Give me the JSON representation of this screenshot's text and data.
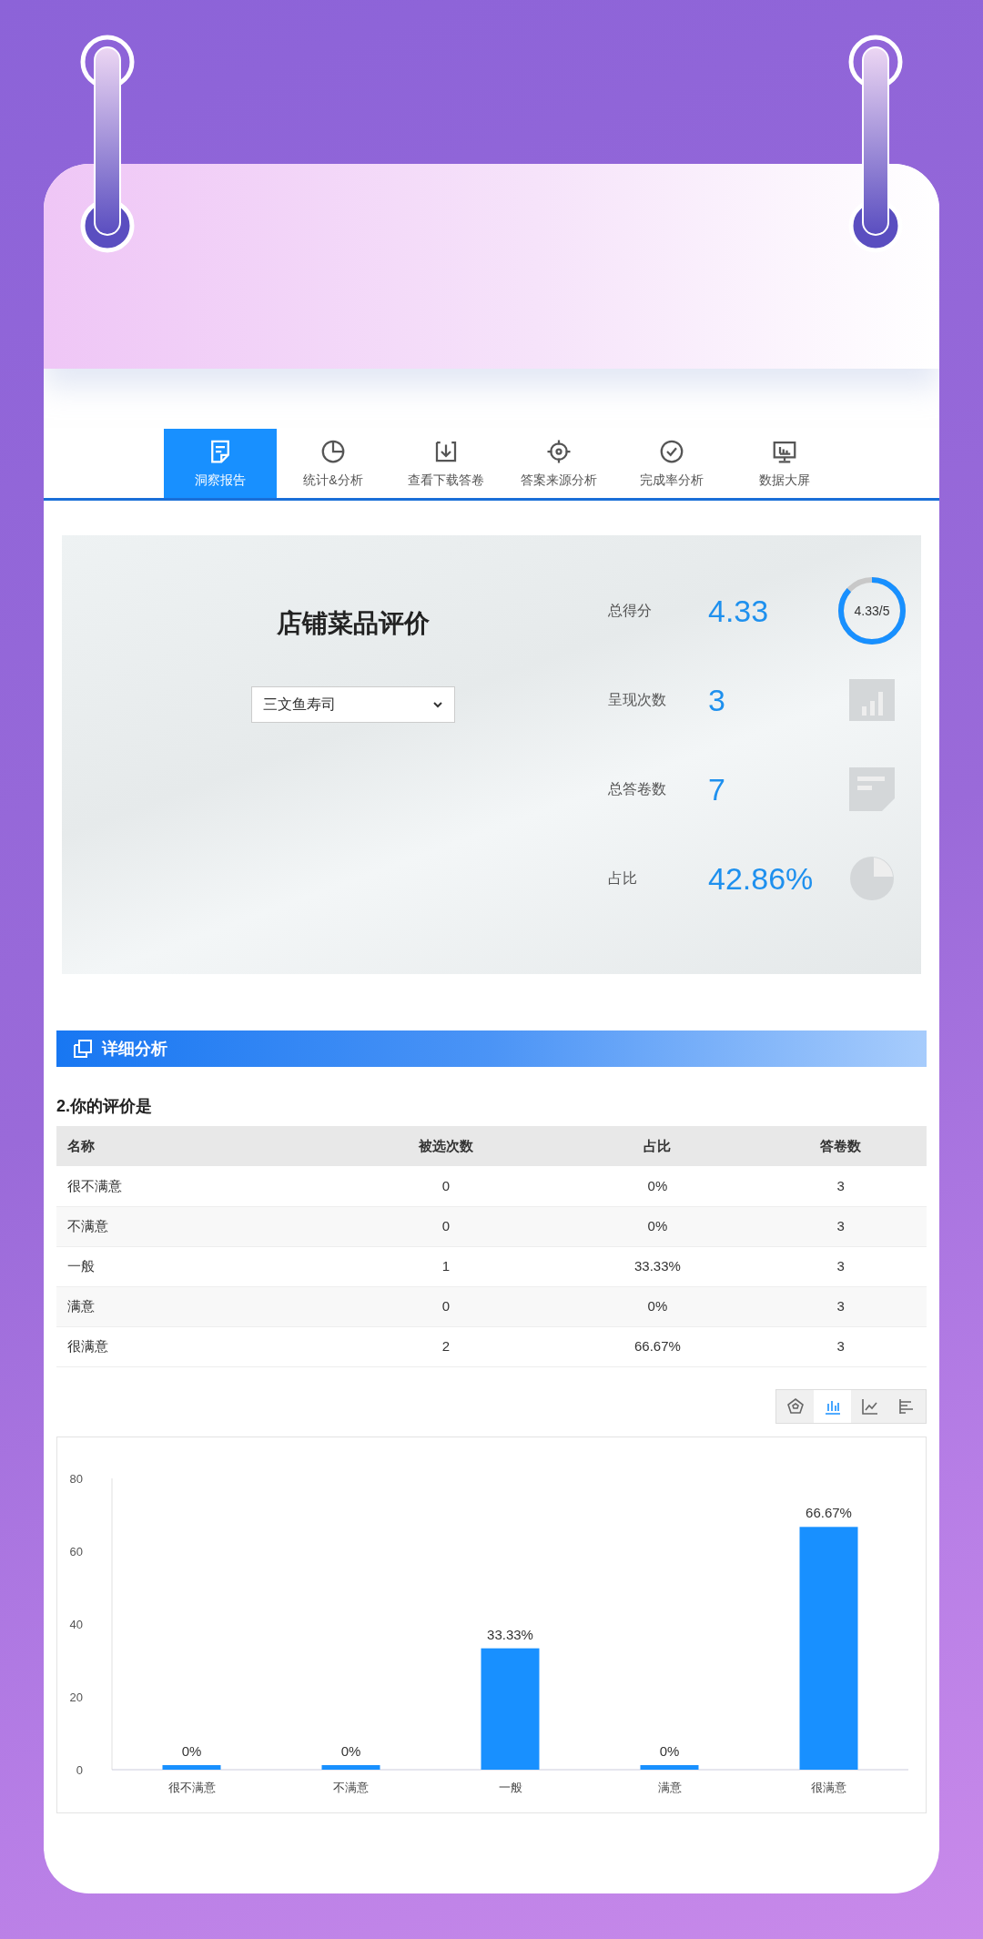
{
  "tabs": [
    {
      "label": "洞察报告",
      "selected": true
    },
    {
      "label": "统计&分析",
      "selected": false
    },
    {
      "label": "查看下载答卷",
      "selected": false
    },
    {
      "label": "答案来源分析",
      "selected": false
    },
    {
      "label": "完成率分析",
      "selected": false
    },
    {
      "label": "数据大屏",
      "selected": false
    }
  ],
  "summary": {
    "title": "店铺菜品评价",
    "select": {
      "value": "三文鱼寿司"
    },
    "stats": [
      {
        "kind": "ring",
        "label": "总得分",
        "value": "4.33",
        "ring_text": "4.33/5"
      },
      {
        "kind": "bars",
        "label": "呈现次数",
        "value": "3"
      },
      {
        "kind": "note",
        "label": "总答卷数",
        "value": "7"
      },
      {
        "kind": "pie",
        "label": "占比",
        "value": "42.86%"
      }
    ]
  },
  "section": {
    "title": "详细分析"
  },
  "question": {
    "title": "2.你的评价是",
    "table": {
      "columns": [
        "名称",
        "被选次数",
        "占比",
        "答卷数"
      ],
      "rows": [
        [
          "很不满意",
          "0",
          "0%",
          "3"
        ],
        [
          "不满意",
          "0",
          "0%",
          "3"
        ],
        [
          "一般",
          "1",
          "33.33%",
          "3"
        ],
        [
          "满意",
          "0",
          "0%",
          "3"
        ],
        [
          "很满意",
          "2",
          "66.67%",
          "3"
        ]
      ]
    },
    "chart_toolbar": [
      {
        "kind": "radar",
        "selected": false
      },
      {
        "kind": "bar",
        "selected": true
      },
      {
        "kind": "line",
        "selected": false
      },
      {
        "kind": "hbar",
        "selected": false
      }
    ],
    "chart_data": {
      "type": "bar",
      "categories": [
        "很不满意",
        "不满意",
        "一般",
        "满意",
        "很满意"
      ],
      "series": [
        {
          "color": "#1890ff",
          "values": [
            0,
            0,
            33.33,
            0,
            66.67
          ]
        }
      ],
      "ylim": [
        0,
        80
      ],
      "yticks": [
        0,
        20,
        40,
        60,
        80
      ],
      "value_labels": [
        "0%",
        "0%",
        "33.33%",
        "0%",
        "66.67%"
      ]
    }
  }
}
